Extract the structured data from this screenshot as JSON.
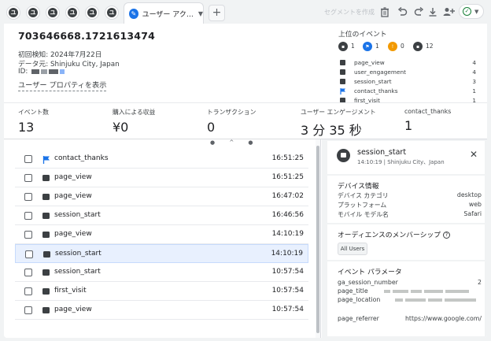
{
  "tabs": {
    "mini": [
      "ユ",
      "ユ",
      "ユ",
      "ユ",
      "ユ",
      "ユ"
    ],
    "active_label": "ユーザー アク…",
    "plus": "+"
  },
  "toolbar": {
    "segment_label": "セグメントを作成"
  },
  "user": {
    "id": "703646668.1721613474",
    "first_seen": "初回検知: 2024年7月22日",
    "location": "データ元: Shinjuku City, Japan",
    "id_label": "ID:",
    "properties_link": "ユーザー プロパティを表示"
  },
  "top_events": {
    "title": "上位のイベント",
    "counts": [
      "1",
      "1",
      "0",
      "12"
    ],
    "items": [
      {
        "name": "page_view",
        "count": "4"
      },
      {
        "name": "user_engagement",
        "count": "4"
      },
      {
        "name": "session_start",
        "count": "3"
      },
      {
        "name": "contact_thanks",
        "count": "1"
      },
      {
        "name": "first_visit",
        "count": "1"
      }
    ]
  },
  "metrics": [
    {
      "label": "イベント数",
      "value": "13"
    },
    {
      "label": "購入による収益",
      "value": "¥0"
    },
    {
      "label": "トランザクション",
      "value": "0"
    },
    {
      "label": "ユーザー エンゲージメント",
      "value": "3 分 35 秒"
    },
    {
      "label": "contact_thanks",
      "value": "1"
    }
  ],
  "events": [
    {
      "name": "contact_thanks",
      "time": "16:51:25",
      "icon": "flag"
    },
    {
      "name": "page_view",
      "time": "16:51:25",
      "icon": "event"
    },
    {
      "name": "page_view",
      "time": "16:47:02",
      "icon": "event"
    },
    {
      "name": "session_start",
      "time": "16:46:56",
      "icon": "event"
    },
    {
      "name": "page_view",
      "time": "14:10:19",
      "icon": "event"
    },
    {
      "name": "session_start",
      "time": "14:10:19",
      "icon": "event",
      "selected": true
    },
    {
      "name": "session_start",
      "time": "10:57:54",
      "icon": "event"
    },
    {
      "name": "first_visit",
      "time": "10:57:54",
      "icon": "event"
    },
    {
      "name": "page_view",
      "time": "10:57:54",
      "icon": "event"
    }
  ],
  "detail": {
    "title": "session_start",
    "subtitle": "14:10:19 | Shinjuku City、Japan",
    "device_section": "デバイス情報",
    "device": [
      {
        "k": "デバイス カテゴリ",
        "v": "desktop"
      },
      {
        "k": "プラットフォーム",
        "v": "web"
      },
      {
        "k": "モバイル モデル名",
        "v": "Safari"
      }
    ],
    "audience_section": "オーディエンスのメンバーシップ",
    "audience_chip": "All Users",
    "params_section": "イベント パラメータ",
    "params": [
      {
        "k": "ga_session_number",
        "v": "2"
      },
      {
        "k": "page_title",
        "v": ""
      },
      {
        "k": "page_location",
        "v": ""
      },
      {
        "k": "page_referrer",
        "v": "https://www.google.com/"
      }
    ]
  },
  "colors": {
    "accent": "#1a73e8",
    "warning": "#f29900",
    "success": "#188038",
    "selected_row": "#e8f0fe"
  }
}
